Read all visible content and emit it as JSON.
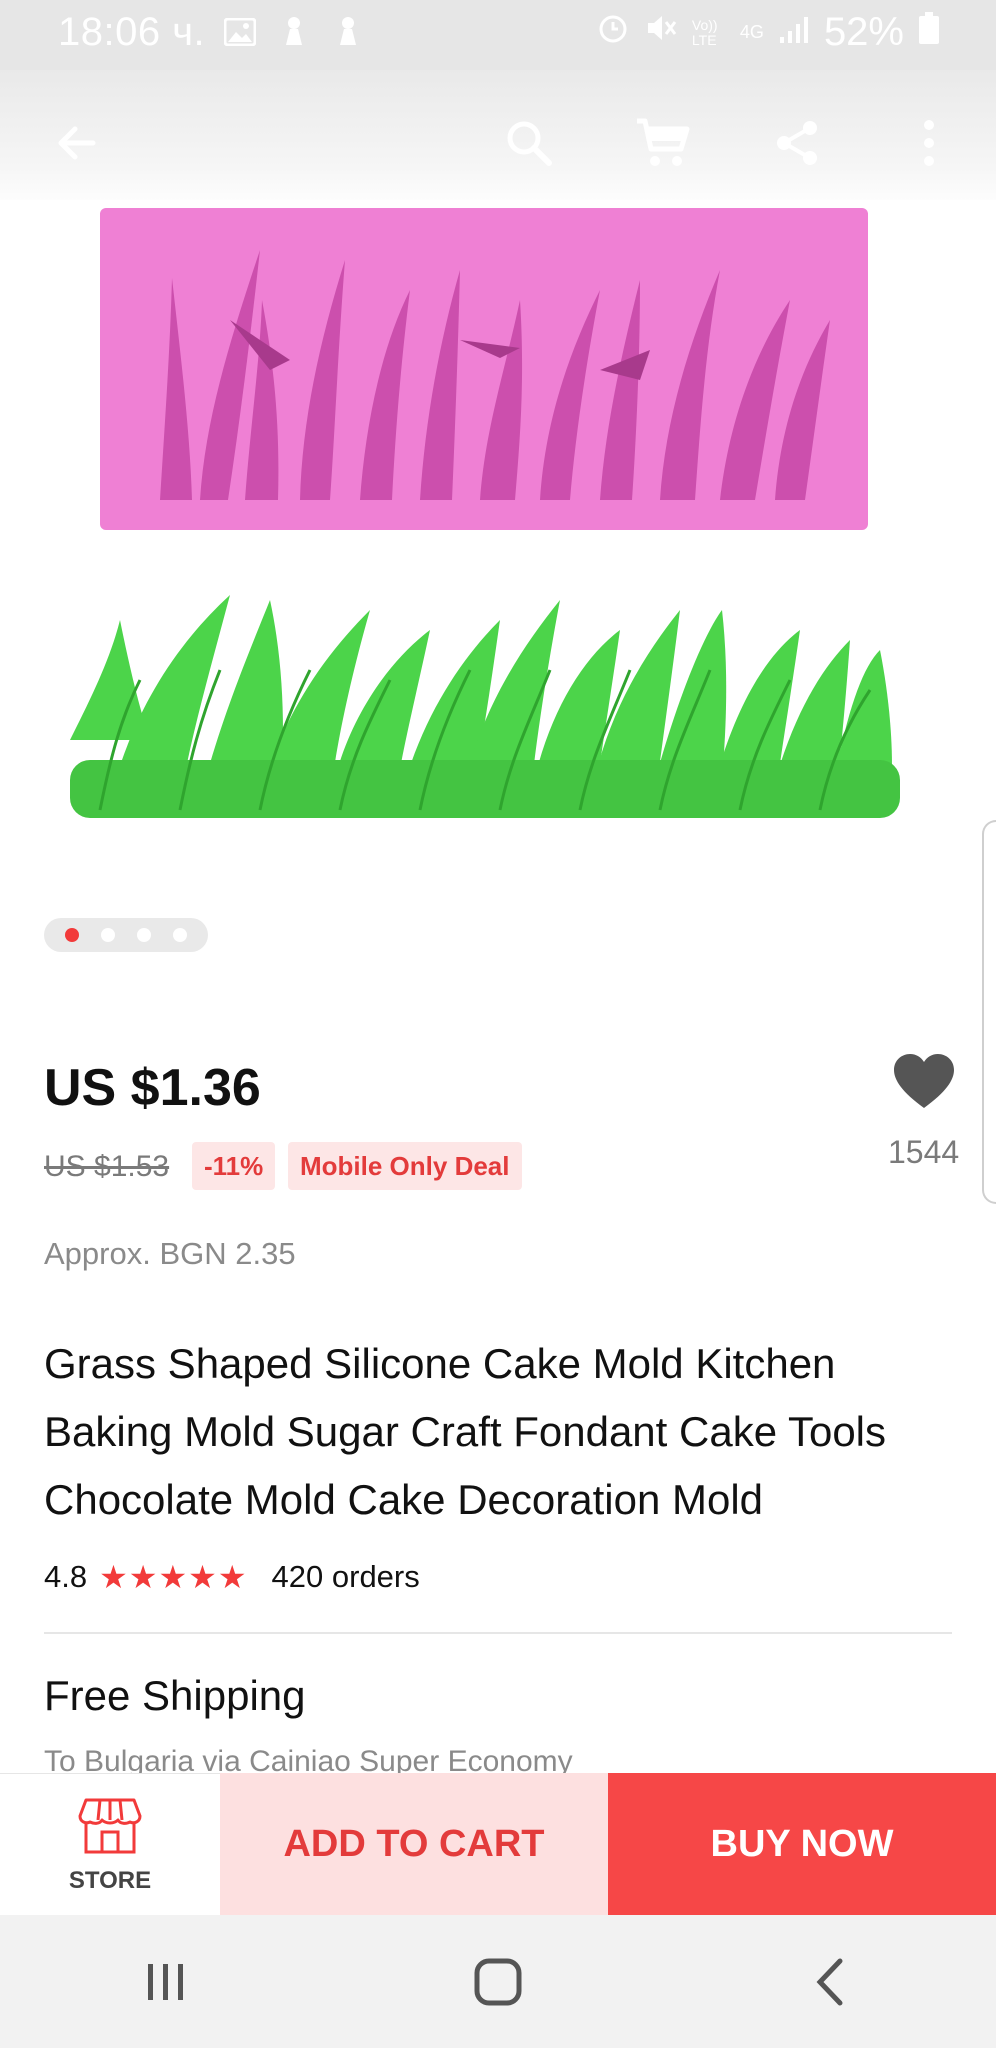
{
  "status_bar": {
    "time": "18:06 ч.",
    "network": "4G",
    "volte": "Vo)) LTE",
    "battery": "52%"
  },
  "top_bar": {
    "icons": [
      "back-arrow-icon",
      "search-icon",
      "cart-icon",
      "share-icon",
      "more-vert-icon"
    ]
  },
  "gallery": {
    "total": 4,
    "active_index": 0
  },
  "product": {
    "price": "US $1.36",
    "original_price": "US $1.53",
    "discount": "-11%",
    "deal_badge": "Mobile Only Deal",
    "wishlist_count": "1544",
    "approx_price": "Approx. BGN 2.35",
    "title": "Grass Shaped Silicone Cake Mold Kitchen Baking Mold Sugar Craft Fondant Cake Tools Chocolate Mold Cake Decoration Mold",
    "rating": "4.8",
    "stars": "★★★★★",
    "orders": "420 orders"
  },
  "shipping": {
    "title": "Free Shipping",
    "subtitle": "To Bulgaria via Cainiao Super Economy"
  },
  "actions": {
    "store_label": "STORE",
    "add_to_cart": "ADD TO CART",
    "buy_now": "BUY NOW"
  },
  "colors": {
    "accent": "#f64747",
    "accent_light": "#fde0e0",
    "mold_pink": "#ef7fd3",
    "grass_green": "#4cd44a"
  }
}
